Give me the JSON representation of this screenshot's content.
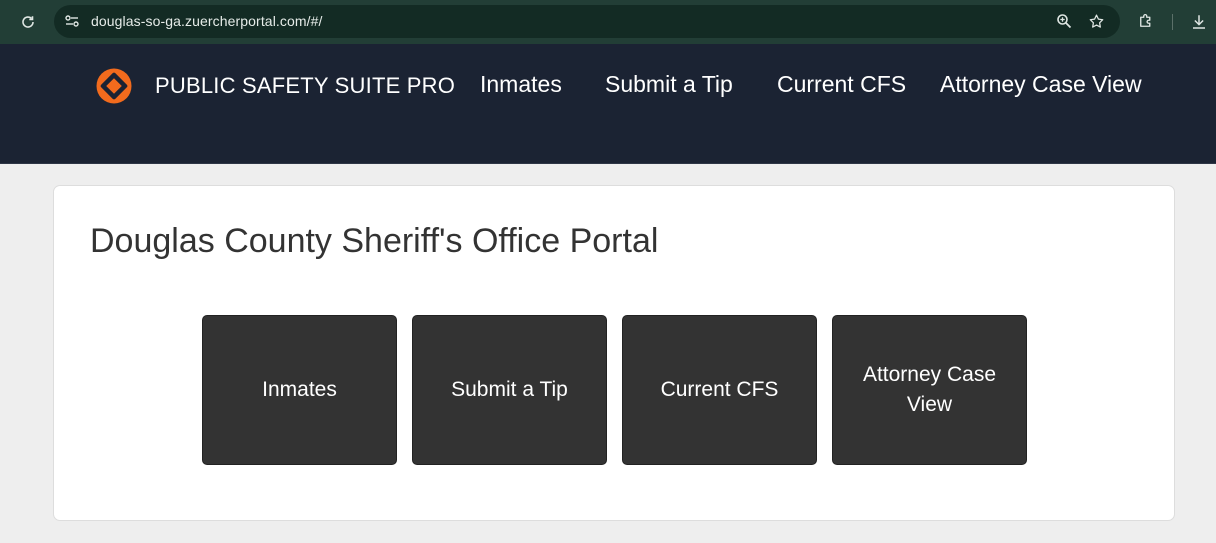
{
  "browser": {
    "url": "douglas-so-ga.zuercherportal.com/#/",
    "icons": [
      "reload-icon",
      "site-info-icon",
      "zoom-icon",
      "bookmark-star-icon",
      "extensions-icon",
      "download-icon"
    ]
  },
  "header": {
    "brand": "PUBLIC SAFETY SUITE PRO",
    "brand_colors": {
      "logo": "#f26b1d",
      "background": "#1b2333"
    },
    "nav": [
      {
        "label": "Inmates"
      },
      {
        "label": "Submit a Tip"
      },
      {
        "label": "Current CFS"
      },
      {
        "label": "Attorney Case View"
      }
    ]
  },
  "main": {
    "title": "Douglas County Sheriff's Office Portal",
    "tiles": [
      {
        "label": "Inmates"
      },
      {
        "label": "Submit a Tip"
      },
      {
        "label": "Current CFS"
      },
      {
        "label": "Attorney Case View"
      }
    ]
  }
}
